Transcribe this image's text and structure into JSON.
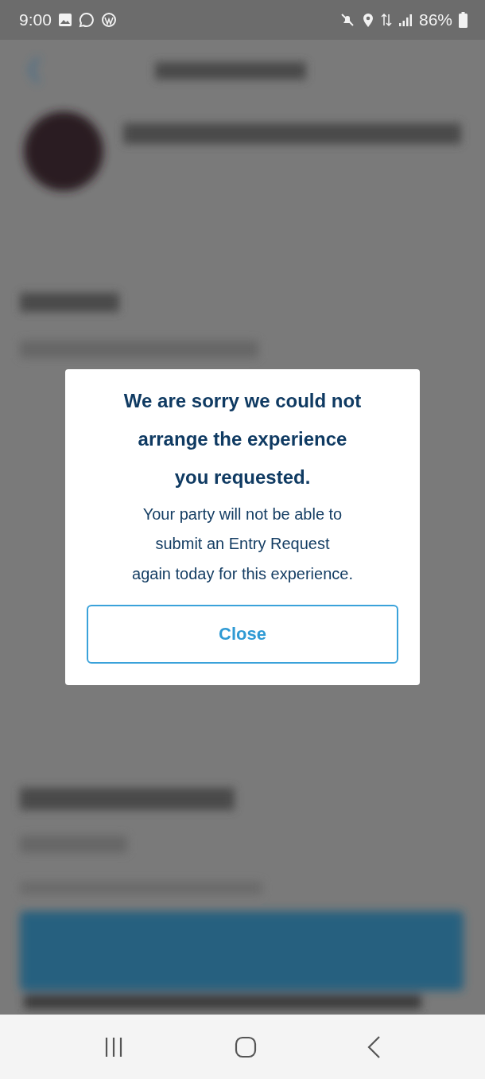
{
  "status_bar": {
    "time": "9:00",
    "battery": "86%"
  },
  "dialog": {
    "title_lines": [
      "We are sorry we could not",
      "arrange the experience",
      "you requested."
    ],
    "message_lines": [
      "Your party will not be able to",
      "submit an Entry Request",
      "again today for this experience."
    ],
    "button": "Close"
  }
}
